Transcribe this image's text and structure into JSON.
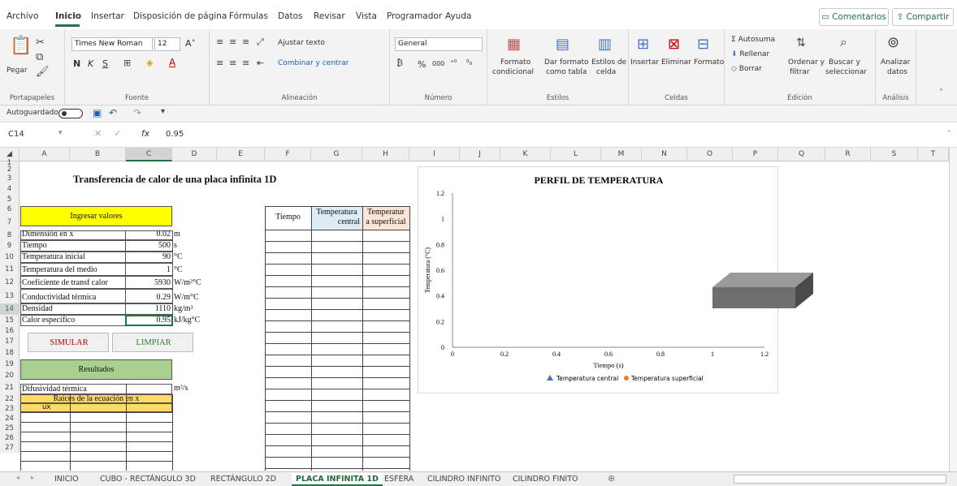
{
  "menu": {
    "items": [
      "Archivo",
      "Inicio",
      "Insertar",
      "Disposición de página",
      "Fórmulas",
      "Datos",
      "Revisar",
      "Vista",
      "Programador",
      "Ayuda"
    ],
    "comments": "Comentarios",
    "share": "Compartir"
  },
  "ribbon": {
    "clipboard": {
      "paste": "Pegar",
      "label": "Portapapeles"
    },
    "font": {
      "name": "Times New Roman",
      "size": "12",
      "bold": "N",
      "italic": "K",
      "underline": "S",
      "label": "Fuente"
    },
    "alignment": {
      "wrap": "Ajustar texto",
      "merge": "Combinar y centrar",
      "label": "Alineación"
    },
    "number": {
      "format": "General",
      "pct": "%",
      "thousands": "000",
      "label": "Número"
    },
    "styles": {
      "cond": "Formato",
      "cond2": "condicional",
      "table": "Dar formato",
      "table2": "como tabla",
      "cell": "Estilos de",
      "cell2": "celda",
      "label": "Estilos"
    },
    "cells": {
      "insert": "Insertar",
      "delete": "Eliminar",
      "format": "Formato",
      "label": "Celdas"
    },
    "editing": {
      "autosum": "Autosuma",
      "fill": "Rellenar",
      "clear": "Borrar",
      "sort": "Ordenar y",
      "sort2": "filtrar",
      "find": "Buscar y",
      "find2": "seleccionar",
      "label": "Edición"
    },
    "analysis": {
      "analyze": "Analizar",
      "analyze2": "datos",
      "label": "Análisis"
    }
  },
  "quick": {
    "autosave": "Autoguardado"
  },
  "formula": {
    "cellref": "C14",
    "fx": "fx",
    "value": "0.95"
  },
  "columns": [
    "A",
    "B",
    "C",
    "D",
    "E",
    "F",
    "G",
    "H",
    "I",
    "J",
    "K",
    "L",
    "M",
    "N",
    "O",
    "P",
    "Q",
    "R",
    "S",
    "T"
  ],
  "rows": [
    "1",
    "2",
    "3",
    "4",
    "5",
    "6",
    "7",
    "8",
    "9",
    "10",
    "11",
    "12",
    "13",
    "14",
    "15",
    "16",
    "17",
    "18",
    "19",
    "20",
    "21",
    "22",
    "23",
    "24",
    "25",
    "26",
    "27"
  ],
  "sheet": {
    "title": "Transferencia de calor de una placa infinita 1D",
    "input_header": "Ingresar valores",
    "inputs": [
      {
        "label": "Dimensión en x",
        "value": "0.02",
        "unit": "m"
      },
      {
        "label": "Tiempo",
        "value": "500",
        "unit": "s"
      },
      {
        "label": "Temperatura inicial",
        "value": "90",
        "unit": "°C"
      },
      {
        "label": "Temperatura del medio",
        "value": "1",
        "unit": "°C"
      },
      {
        "label": "Coeficiente de transf calor",
        "value": "5930",
        "unit": "W/m²°C"
      },
      {
        "label": "Conductividad térmica",
        "value": "0.29",
        "unit": "W/m°C"
      },
      {
        "label": "Densidad",
        "value": "1110",
        "unit": "kg/m³"
      },
      {
        "label": "Calor específico",
        "value": "0.95",
        "unit": "kJ/kg°C"
      }
    ],
    "simulate": "SIMULAR",
    "clear": "LIMPIAR",
    "results_header": "Resultados",
    "diffusivity": "Difusividad térmica",
    "diffusivity_unit": "m²/s",
    "roots_header": "Raíces de la ecuación en x",
    "roots_col": "ux",
    "table_headers": {
      "time": "Tiempo",
      "central1": "Temperatura",
      "central2": "central",
      "surface1": "Temperatur",
      "surface2": "a superficial"
    }
  },
  "chart_data": {
    "type": "scatter",
    "title": "PERFIL DE TEMPERATURA",
    "xlabel": "Tiempo (s)",
    "ylabel": "Temperatura (°C)",
    "xlim": [
      0,
      1.2
    ],
    "ylim": [
      0,
      1.2
    ],
    "xticks": [
      "0",
      "0.2",
      "0.4",
      "0.6",
      "0.8",
      "1",
      "1.2"
    ],
    "yticks": [
      "0",
      "0.2",
      "0.4",
      "0.6",
      "0.8",
      "1",
      "1.2"
    ],
    "series": [
      {
        "name": "Temperatura central",
        "marker": "triangle",
        "color": "#4472c4",
        "values": []
      },
      {
        "name": "Temperatura superficial",
        "marker": "circle",
        "color": "#ed7d31",
        "values": []
      }
    ],
    "legend": "bottom",
    "grid": false
  },
  "tabs": [
    "INICIO",
    "CUBO - RECTÁNGULO 3D",
    "RECTÁNGULO 2D",
    "PLACA INFINITA 1D",
    "ESFERA",
    "CILINDRO INFINITO",
    "CILINDRO FINITO"
  ],
  "active_tab": "PLACA INFINITA 1D",
  "colors": {
    "accent": "#217346",
    "yellow": "#ffff00",
    "green": "#a9d08e",
    "blue": "#ddebf7",
    "peach": "#fce4d6",
    "orange": "#ffd966"
  }
}
